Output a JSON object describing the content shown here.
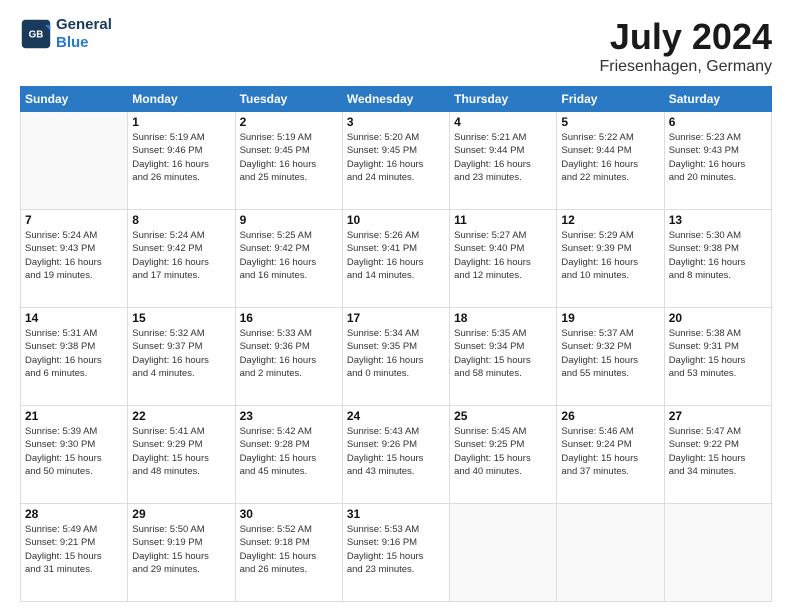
{
  "header": {
    "logo_line1": "General",
    "logo_line2": "Blue",
    "title": "July 2024",
    "subtitle": "Friesenhagen, Germany"
  },
  "weekdays": [
    "Sunday",
    "Monday",
    "Tuesday",
    "Wednesday",
    "Thursday",
    "Friday",
    "Saturday"
  ],
  "weeks": [
    [
      {
        "day": "",
        "content": ""
      },
      {
        "day": "1",
        "content": "Sunrise: 5:19 AM\nSunset: 9:46 PM\nDaylight: 16 hours\nand 26 minutes."
      },
      {
        "day": "2",
        "content": "Sunrise: 5:19 AM\nSunset: 9:45 PM\nDaylight: 16 hours\nand 25 minutes."
      },
      {
        "day": "3",
        "content": "Sunrise: 5:20 AM\nSunset: 9:45 PM\nDaylight: 16 hours\nand 24 minutes."
      },
      {
        "day": "4",
        "content": "Sunrise: 5:21 AM\nSunset: 9:44 PM\nDaylight: 16 hours\nand 23 minutes."
      },
      {
        "day": "5",
        "content": "Sunrise: 5:22 AM\nSunset: 9:44 PM\nDaylight: 16 hours\nand 22 minutes."
      },
      {
        "day": "6",
        "content": "Sunrise: 5:23 AM\nSunset: 9:43 PM\nDaylight: 16 hours\nand 20 minutes."
      }
    ],
    [
      {
        "day": "7",
        "content": "Sunrise: 5:24 AM\nSunset: 9:43 PM\nDaylight: 16 hours\nand 19 minutes."
      },
      {
        "day": "8",
        "content": "Sunrise: 5:24 AM\nSunset: 9:42 PM\nDaylight: 16 hours\nand 17 minutes."
      },
      {
        "day": "9",
        "content": "Sunrise: 5:25 AM\nSunset: 9:42 PM\nDaylight: 16 hours\nand 16 minutes."
      },
      {
        "day": "10",
        "content": "Sunrise: 5:26 AM\nSunset: 9:41 PM\nDaylight: 16 hours\nand 14 minutes."
      },
      {
        "day": "11",
        "content": "Sunrise: 5:27 AM\nSunset: 9:40 PM\nDaylight: 16 hours\nand 12 minutes."
      },
      {
        "day": "12",
        "content": "Sunrise: 5:29 AM\nSunset: 9:39 PM\nDaylight: 16 hours\nand 10 minutes."
      },
      {
        "day": "13",
        "content": "Sunrise: 5:30 AM\nSunset: 9:38 PM\nDaylight: 16 hours\nand 8 minutes."
      }
    ],
    [
      {
        "day": "14",
        "content": "Sunrise: 5:31 AM\nSunset: 9:38 PM\nDaylight: 16 hours\nand 6 minutes."
      },
      {
        "day": "15",
        "content": "Sunrise: 5:32 AM\nSunset: 9:37 PM\nDaylight: 16 hours\nand 4 minutes."
      },
      {
        "day": "16",
        "content": "Sunrise: 5:33 AM\nSunset: 9:36 PM\nDaylight: 16 hours\nand 2 minutes."
      },
      {
        "day": "17",
        "content": "Sunrise: 5:34 AM\nSunset: 9:35 PM\nDaylight: 16 hours\nand 0 minutes."
      },
      {
        "day": "18",
        "content": "Sunrise: 5:35 AM\nSunset: 9:34 PM\nDaylight: 15 hours\nand 58 minutes."
      },
      {
        "day": "19",
        "content": "Sunrise: 5:37 AM\nSunset: 9:32 PM\nDaylight: 15 hours\nand 55 minutes."
      },
      {
        "day": "20",
        "content": "Sunrise: 5:38 AM\nSunset: 9:31 PM\nDaylight: 15 hours\nand 53 minutes."
      }
    ],
    [
      {
        "day": "21",
        "content": "Sunrise: 5:39 AM\nSunset: 9:30 PM\nDaylight: 15 hours\nand 50 minutes."
      },
      {
        "day": "22",
        "content": "Sunrise: 5:41 AM\nSunset: 9:29 PM\nDaylight: 15 hours\nand 48 minutes."
      },
      {
        "day": "23",
        "content": "Sunrise: 5:42 AM\nSunset: 9:28 PM\nDaylight: 15 hours\nand 45 minutes."
      },
      {
        "day": "24",
        "content": "Sunrise: 5:43 AM\nSunset: 9:26 PM\nDaylight: 15 hours\nand 43 minutes."
      },
      {
        "day": "25",
        "content": "Sunrise: 5:45 AM\nSunset: 9:25 PM\nDaylight: 15 hours\nand 40 minutes."
      },
      {
        "day": "26",
        "content": "Sunrise: 5:46 AM\nSunset: 9:24 PM\nDaylight: 15 hours\nand 37 minutes."
      },
      {
        "day": "27",
        "content": "Sunrise: 5:47 AM\nSunset: 9:22 PM\nDaylight: 15 hours\nand 34 minutes."
      }
    ],
    [
      {
        "day": "28",
        "content": "Sunrise: 5:49 AM\nSunset: 9:21 PM\nDaylight: 15 hours\nand 31 minutes."
      },
      {
        "day": "29",
        "content": "Sunrise: 5:50 AM\nSunset: 9:19 PM\nDaylight: 15 hours\nand 29 minutes."
      },
      {
        "day": "30",
        "content": "Sunrise: 5:52 AM\nSunset: 9:18 PM\nDaylight: 15 hours\nand 26 minutes."
      },
      {
        "day": "31",
        "content": "Sunrise: 5:53 AM\nSunset: 9:16 PM\nDaylight: 15 hours\nand 23 minutes."
      },
      {
        "day": "",
        "content": ""
      },
      {
        "day": "",
        "content": ""
      },
      {
        "day": "",
        "content": ""
      }
    ]
  ]
}
